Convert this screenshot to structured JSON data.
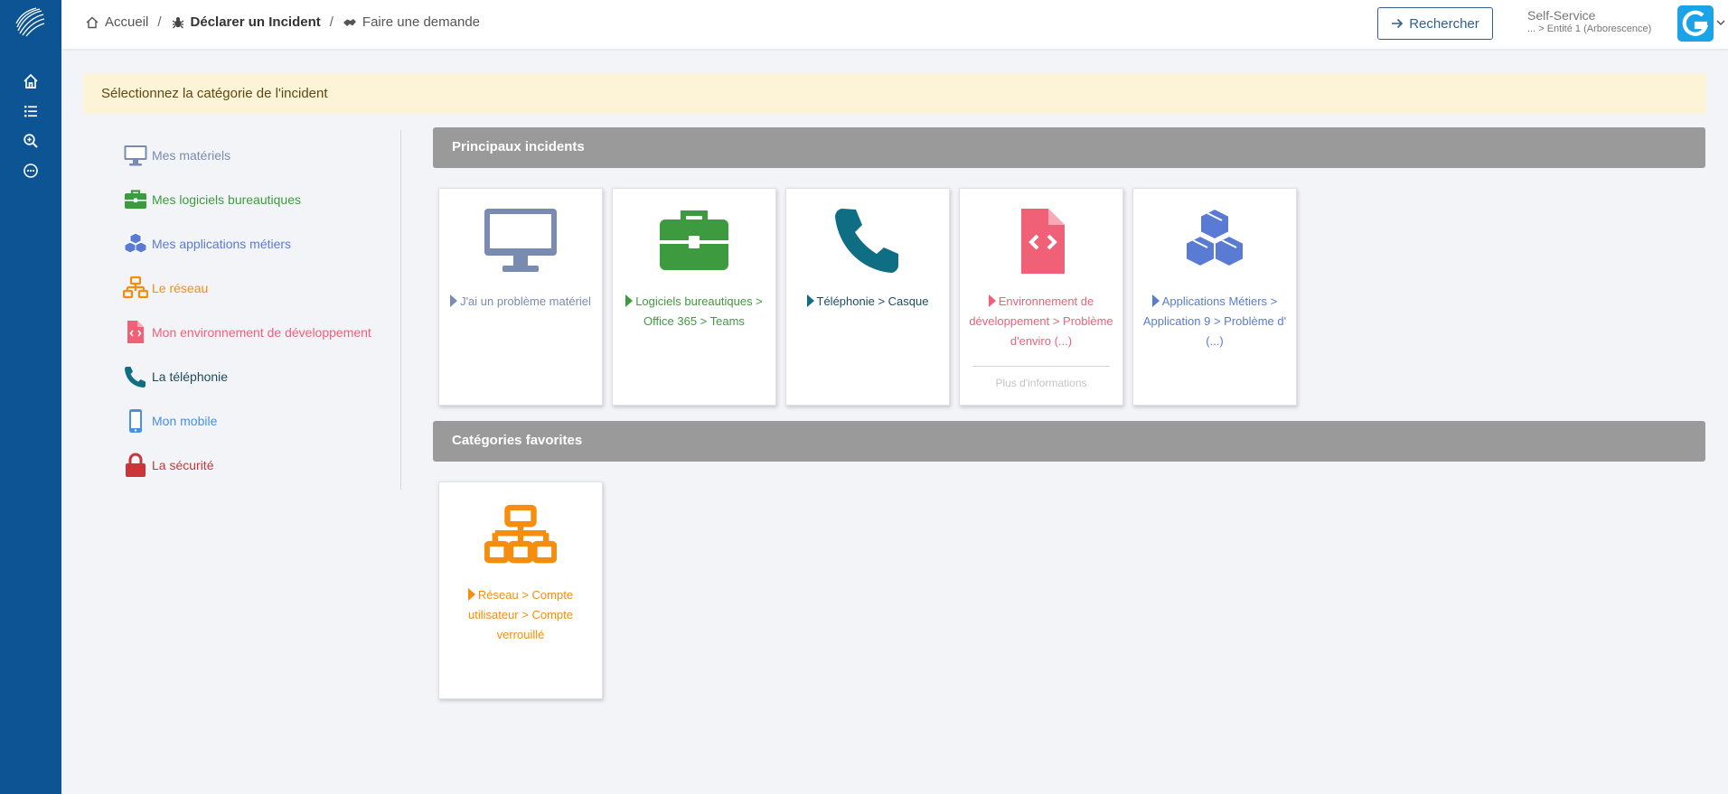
{
  "breadcrumb": {
    "home": "Accueil",
    "incident": "Déclarer un Incident",
    "request": "Faire une demande"
  },
  "header": {
    "search_label": "Rechercher",
    "profile_name": "Self-Service",
    "entity": "... > Entité 1 (Arborescence)"
  },
  "banner": "Sélectionnez la catégorie de l'incident",
  "categories": [
    {
      "label": "Mes matériels",
      "color": "#7a8bb1",
      "icon": "monitor-icon"
    },
    {
      "label": "Mes logiciels bureautiques",
      "color": "#3e9a3f",
      "icon": "briefcase-icon"
    },
    {
      "label": "Mes applications métiers",
      "color": "#5a7bd4",
      "icon": "cubes-icon"
    },
    {
      "label": "Le réseau",
      "color": "#f58e0e",
      "icon": "network-icon"
    },
    {
      "label": "Mon environnement de développement",
      "color": "#f06178",
      "icon": "file-code-icon"
    },
    {
      "label": "La téléphonie",
      "color": "#0f6e83",
      "icon": "phone-icon"
    },
    {
      "label": "Mon mobile",
      "color": "#4a90e2",
      "icon": "mobile-icon"
    },
    {
      "label": "La sécurité",
      "color": "#c9363a",
      "icon": "lock-icon"
    }
  ],
  "sections": {
    "main": "Principaux incidents",
    "favorites": "Catégories favorites"
  },
  "main_tiles": [
    {
      "label": "J'ai un problème matériel",
      "color": "#7a8bb1",
      "icon": "monitor-icon"
    },
    {
      "label": "Logiciels bureautiques > Office 365 > Teams",
      "color": "#3e9a3f",
      "icon": "briefcase-icon"
    },
    {
      "label": "Téléphonie > Casque",
      "color": "#0f6e83",
      "icon": "phone-icon"
    },
    {
      "label": "Environnement de développement > Problème d'enviro (...)",
      "color": "#f06178",
      "icon": "file-code-icon",
      "more": "Plus d'informations"
    },
    {
      "label": "Applications Métiers > Application 9 > Problème d' (...)",
      "color": "#5a7bd4",
      "icon": "cubes-icon"
    }
  ],
  "favorite_tiles": [
    {
      "label": "Réseau > Compte utilisateur > Compte verrouillé",
      "color": "#f58e0e",
      "icon": "network-icon"
    }
  ]
}
